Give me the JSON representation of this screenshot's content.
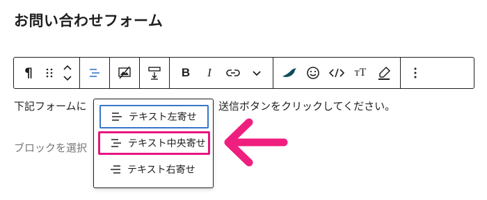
{
  "page": {
    "title": "お問い合わせフォーム"
  },
  "toolbar": {
    "paragraph_glyph": "¶",
    "bold_label": "B",
    "italic_label": "I",
    "text_size_label": "тT"
  },
  "content": {
    "paragraph_text": "下記フォームに",
    "paragraph_text_rest": "送信ボタンをクリックしてください。",
    "placeholder": "ブロックを選択"
  },
  "align_menu": {
    "items": [
      {
        "label": "テキスト左寄せ",
        "icon": "align-left-icon"
      },
      {
        "label": "テキスト中央寄せ",
        "icon": "align-center-icon"
      },
      {
        "label": "テキスト右寄せ",
        "icon": "align-right-icon"
      }
    ]
  },
  "colors": {
    "accent_blue": "#3575c8",
    "highlight_pink": "#e6157f",
    "arrow_pink": "#ef1f7f",
    "toolbar_border": "#1e1e1e"
  }
}
